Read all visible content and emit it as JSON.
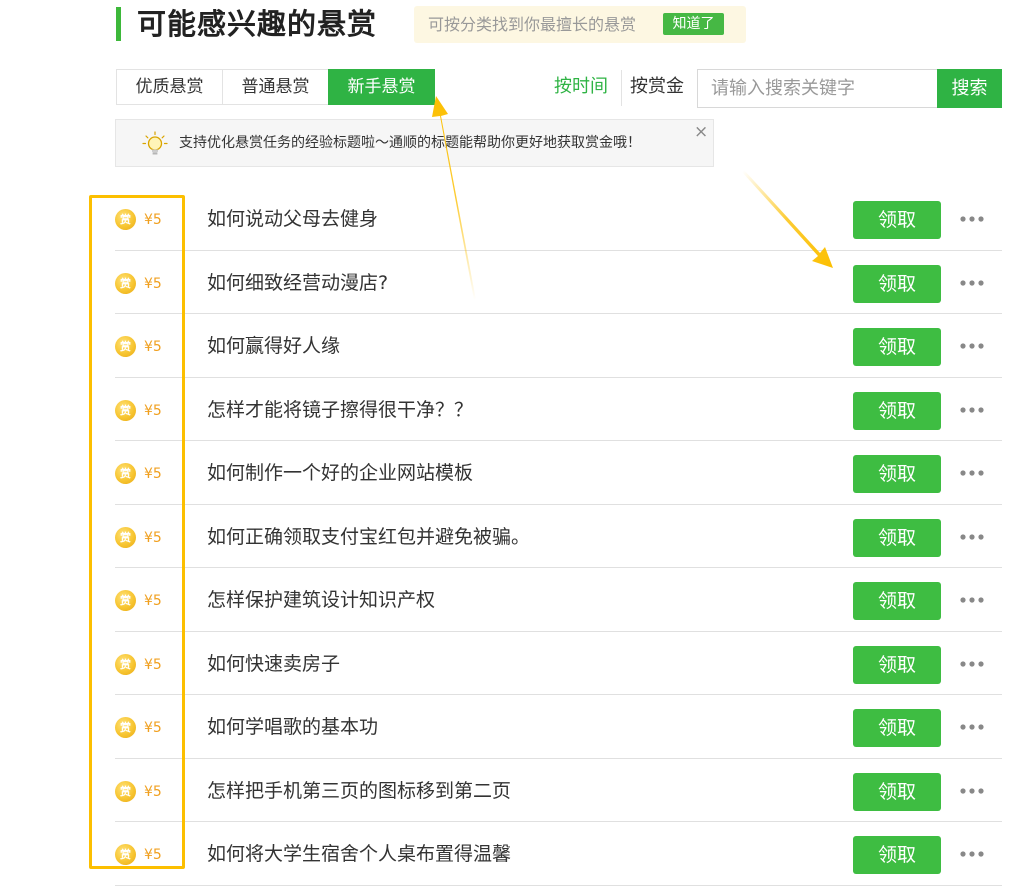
{
  "header": {
    "title": "可能感兴趣的悬赏",
    "hint_text": "可按分类找到你最擅长的悬赏",
    "got_it_label": "知道了"
  },
  "tabs": [
    {
      "label": "优质悬赏",
      "active": false
    },
    {
      "label": "普通悬赏",
      "active": false
    },
    {
      "label": "新手悬赏",
      "active": true
    }
  ],
  "sort": {
    "by_time": "按时间",
    "by_bounty": "按赏金",
    "active": "by_time"
  },
  "search": {
    "placeholder": "请输入搜索关键字",
    "value": "",
    "button_label": "搜索"
  },
  "notice": {
    "text": "支持优化悬赏任务的经验标题啦～通顺的标题能帮助你更好地获取赏金哦！",
    "close_glyph": "×",
    "icon": "lightbulb-icon"
  },
  "bounties": [
    {
      "coin_label": "赏",
      "amount": "¥5",
      "title": "如何说动父母去健身",
      "action": "领取"
    },
    {
      "coin_label": "赏",
      "amount": "¥5",
      "title": "如何细致经营动漫店?",
      "action": "领取"
    },
    {
      "coin_label": "赏",
      "amount": "¥5",
      "title": "如何赢得好人缘",
      "action": "领取"
    },
    {
      "coin_label": "赏",
      "amount": "¥5",
      "title": "怎样才能将镜子擦得很干净？？",
      "action": "领取"
    },
    {
      "coin_label": "赏",
      "amount": "¥5",
      "title": "如何制作一个好的企业网站模板",
      "action": "领取"
    },
    {
      "coin_label": "赏",
      "amount": "¥5",
      "title": "如何正确领取支付宝红包并避免被骗。",
      "action": "领取"
    },
    {
      "coin_label": "赏",
      "amount": "¥5",
      "title": "怎样保护建筑设计知识产权",
      "action": "领取"
    },
    {
      "coin_label": "赏",
      "amount": "¥5",
      "title": "如何快速卖房子",
      "action": "领取"
    },
    {
      "coin_label": "赏",
      "amount": "¥5",
      "title": "如何学唱歌的基本功",
      "action": "领取"
    },
    {
      "coin_label": "赏",
      "amount": "¥5",
      "title": "怎样把手机第三页的图标移到第二页",
      "action": "领取"
    },
    {
      "coin_label": "赏",
      "amount": "¥5",
      "title": "如何将大学生宿舍个人桌布置得温馨",
      "action": "领取"
    }
  ],
  "colors": {
    "brand_green": "#2fb344",
    "claim_green": "#3ebd42",
    "annotation_yellow": "#fcbf00",
    "amount_orange": "#f0a020"
  }
}
